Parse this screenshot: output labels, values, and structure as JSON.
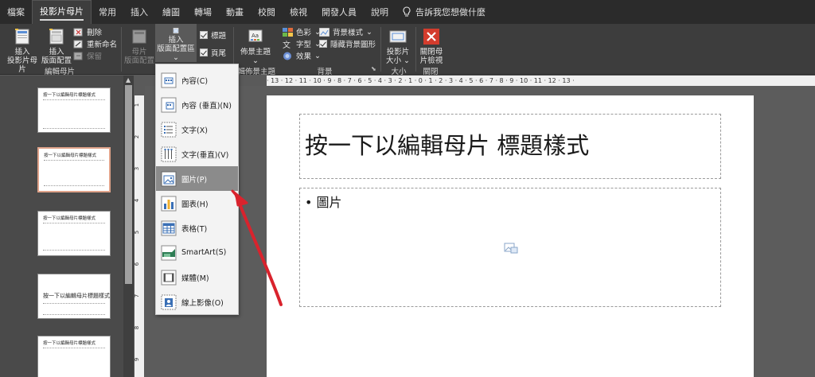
{
  "tabs": [
    "檔案",
    "投影片母片",
    "常用",
    "插入",
    "繪圖",
    "轉場",
    "動畫",
    "校閱",
    "檢視",
    "開發人員",
    "說明"
  ],
  "tell_me": "告訴我您想做什麼",
  "ribbon": {
    "insert_master_l1": "插入",
    "insert_master_l2": "投影片母片",
    "insert_layout_l1": "插入",
    "insert_layout_l2": "版面配置",
    "delete": "刪除",
    "rename": "重新命名",
    "preserve": "保留",
    "master_layout_l1": "母片",
    "master_layout_l2": "版面配置",
    "insert_placeholder_l1": "插入",
    "insert_placeholder_l2": "版面配置區",
    "chk_title": "標題",
    "chk_footer": "頁尾",
    "themes": "佈景主題",
    "colors": "色彩",
    "fonts": "字型",
    "effects": "效果",
    "bg_styles": "背景樣式",
    "hide_bg": "隱藏背景圖形",
    "slide_size_l1": "投影片",
    "slide_size_l2": "大小",
    "close_l1": "關閉母",
    "close_l2": "片檢視",
    "group_edit_master": "編輯母片",
    "group_edit_theme": "編輯佈景主題",
    "group_background": "背景",
    "group_size": "大小",
    "group_close": "關閉"
  },
  "ruler_text": "· 13 · 12 · 11 · 10 · 9 · 8 · 7 · 6 · 5 · 4 · 3 · 2 · 1 · 0 · 1 · 2 · 3 · 4 · 5 · 6 · 7 · 8 · 9 · 10 · 11 · 12 · 13 ·",
  "vruler": [
    "1",
    "2",
    "3",
    "4",
    "5",
    "6",
    "7",
    "8",
    "9"
  ],
  "thumbnails": {
    "t1": "按一下以編輯母片標題樣式",
    "t2": "按一下以編輯母片標題樣式",
    "t3": "按一下以編輯母片標題樣式",
    "t4": "按一下以編輯母片標題樣式",
    "t5": "按一下以編輯母片標題樣式"
  },
  "slide": {
    "title": "按一下以編輯母片 標題樣式",
    "content": "• 圖片"
  },
  "menu": [
    {
      "label": "內容(C)",
      "icon": "content-icon"
    },
    {
      "label": "內容 (垂直)(N)",
      "icon": "content-vertical-icon"
    },
    {
      "label": "文字(X)",
      "icon": "text-icon"
    },
    {
      "label": "文字(垂直)(V)",
      "icon": "text-vertical-icon"
    },
    {
      "label": "圖片(P)",
      "icon": "picture-icon"
    },
    {
      "label": "圖表(H)",
      "icon": "chart-icon"
    },
    {
      "label": "表格(T)",
      "icon": "table-icon"
    },
    {
      "label": "SmartArt(S)",
      "icon": "smartart-icon"
    },
    {
      "label": "媒體(M)",
      "icon": "media-icon"
    },
    {
      "label": "線上影像(O)",
      "icon": "online-picture-icon"
    }
  ],
  "colors": {
    "accent_arrow": "#d9232d",
    "highlight": "#8b8b8b",
    "ribbon_bg": "#3d3d3d"
  }
}
